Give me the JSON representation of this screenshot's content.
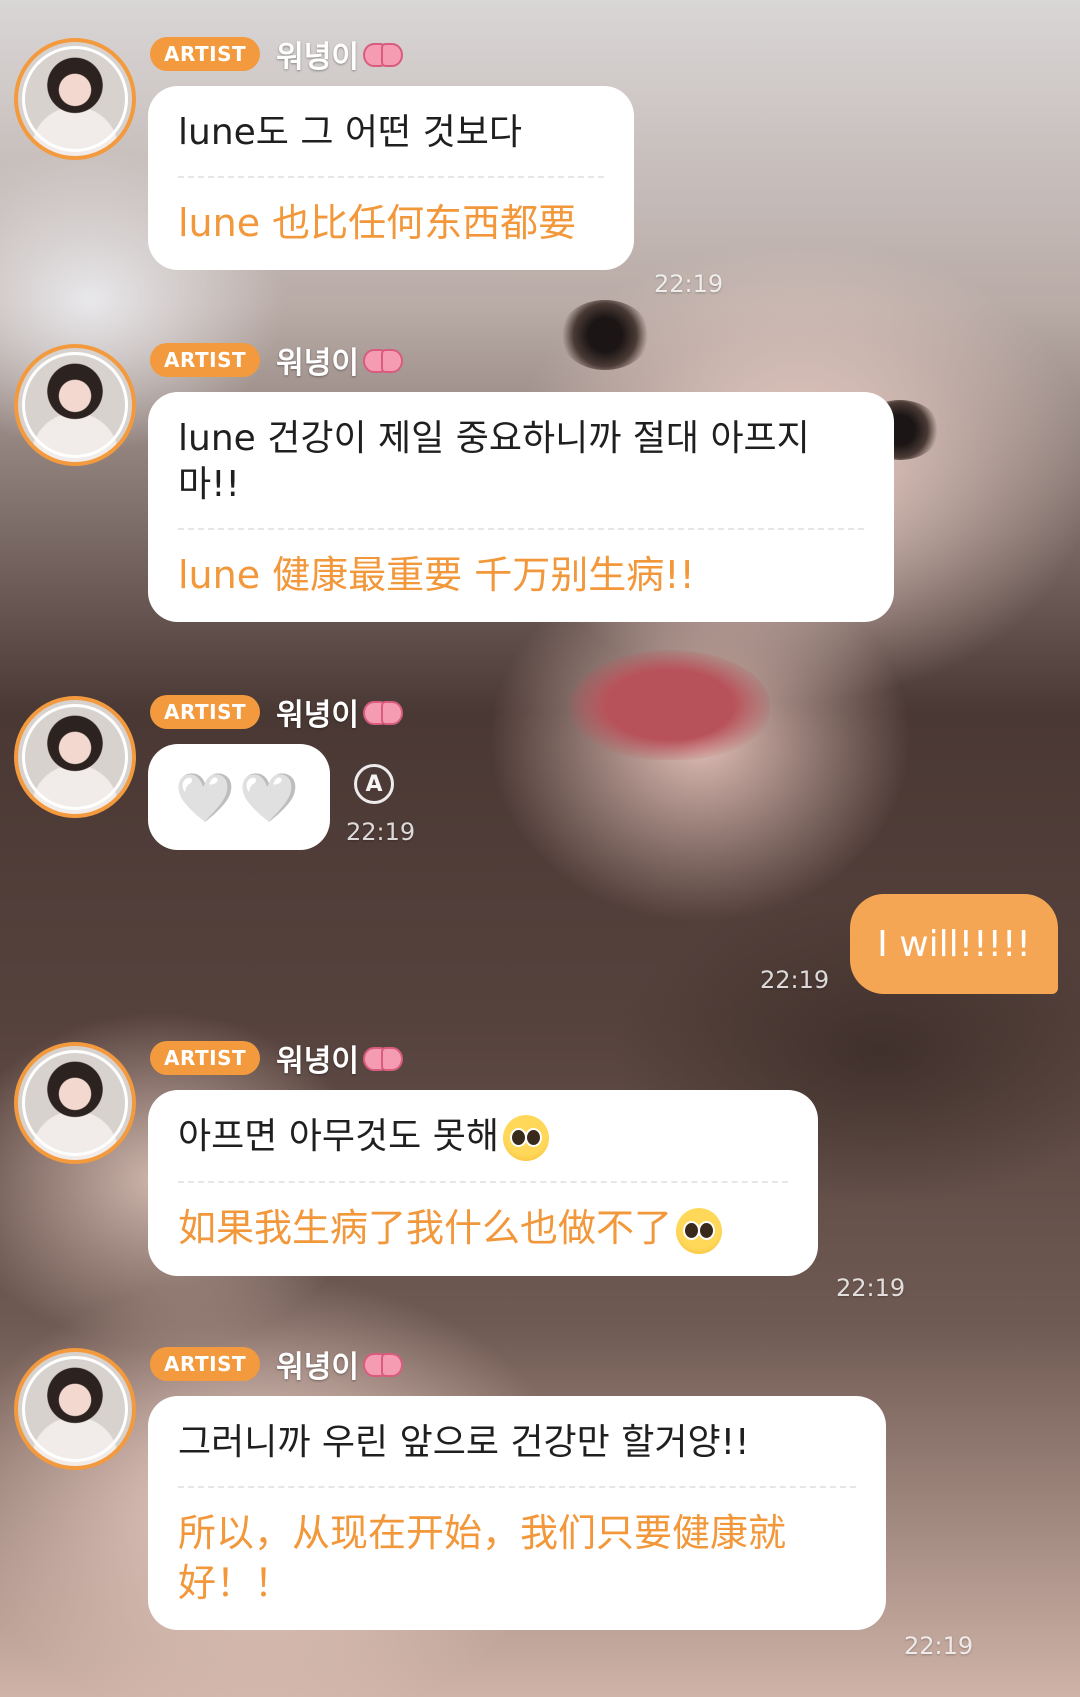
{
  "sender": {
    "badge": "ARTIST",
    "name": "워녕이"
  },
  "messages": [
    {
      "ko": "lune도 그 어떤 것보다",
      "zh": "lune 也比任何东西都要",
      "time": "22:19"
    },
    {
      "ko": "lune 건강이 제일 중요하니까 절대 아프지 마!!",
      "zh": "lune 健康最重要 千万别生病!!",
      "time": ""
    },
    {
      "hearts": "🤍🤍",
      "translate_label": "A",
      "time": "22:19"
    },
    {
      "ko": "아프면 아무것도 못해",
      "zh": "如果我生病了我什么也做不了",
      "time": "22:19"
    },
    {
      "ko": "그러니까 우린 앞으로 건강만 할거양!!",
      "zh": "所以，从现在开始，我们只要健康就好！！",
      "time": "22:19"
    }
  ],
  "my_message": {
    "text": "I will!!!!!",
    "time": "22:19"
  },
  "icons": {
    "bow": "bow-emoji-icon",
    "pleading": "pleading-face-emoji-icon",
    "translate": "translate-icon"
  },
  "colors": {
    "accent": "#f39a3e",
    "my_bubble": "#f5a655",
    "translated_text": "#f2973a"
  }
}
